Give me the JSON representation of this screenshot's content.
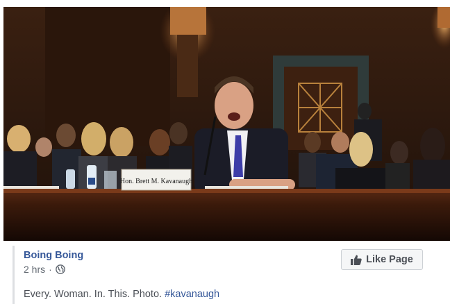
{
  "photo": {
    "nameplate": "Hon. Brett M. Kavanaugh",
    "alt": "Man testifying at a hearing with women seated behind him"
  },
  "post": {
    "page_name": "Boing Boing",
    "time": "2 hrs",
    "separator": "·",
    "privacy_icon": "globe-icon",
    "caption_text": "Every. Woman. In. This. Photo. ",
    "hashtag": "#kavanaugh"
  },
  "like_button": {
    "icon": "thumbs-up-icon",
    "label": "Like Page"
  },
  "colors": {
    "link": "#365899",
    "meta": "#606770",
    "caption": "#4b4f56",
    "button_bg": "#f5f6f7",
    "button_border": "#ccd0d5"
  }
}
